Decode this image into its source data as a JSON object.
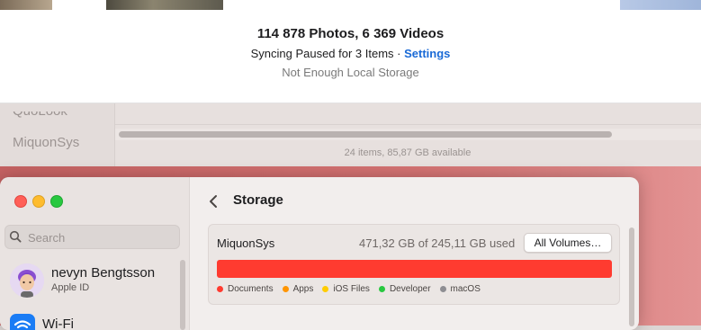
{
  "photos": {
    "counts": "114 878 Photos, 6 369 Videos",
    "sync_prefix": "Syncing Paused for 3 Items · ",
    "settings_link": "Settings",
    "storage_note": "Not Enough Local Storage"
  },
  "finder": {
    "sidebar_items": [
      "QuoLook",
      "MiquonSys"
    ],
    "status": "24 items, 85,87 GB available"
  },
  "settings": {
    "search_placeholder": "Search",
    "user_name": "nevyn Bengtsson",
    "user_sub": "Apple ID",
    "next_item": "Wi-Fi",
    "page_title": "Storage",
    "volume_name": "MiquonSys",
    "usage": "471,32 GB of 245,11 GB used",
    "all_volumes_button": "All Volumes…",
    "legend": [
      {
        "label": "Documents",
        "color": "#ff3b30"
      },
      {
        "label": "Apps",
        "color": "#ff9500"
      },
      {
        "label": "iOS Files",
        "color": "#ffcc00"
      },
      {
        "label": "Developer",
        "color": "#28c840"
      },
      {
        "label": "macOS",
        "color": "#8e8e93"
      }
    ],
    "bar_color": "#ff3b30",
    "icons": [
      "search-icon",
      "chevron-left-icon",
      "memoji-avatar",
      "wifi-icon"
    ]
  }
}
